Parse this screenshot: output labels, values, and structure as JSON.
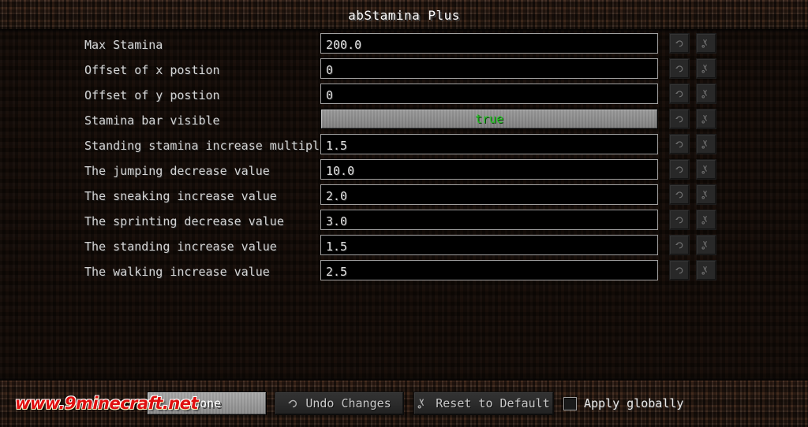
{
  "window": {
    "title": "abStamina Plus"
  },
  "options": [
    {
      "label": "Max Stamina",
      "type": "text",
      "value": "200.0"
    },
    {
      "label": "Offset of x postion",
      "type": "text",
      "value": "0"
    },
    {
      "label": "Offset of y postion",
      "type": "text",
      "value": "0"
    },
    {
      "label": "Stamina bar visible",
      "type": "boolean",
      "value": "true"
    },
    {
      "label": "Standing stamina increase multiplier",
      "type": "text",
      "value": "1.5"
    },
    {
      "label": "The jumping decrease value",
      "type": "text",
      "value": "10.0"
    },
    {
      "label": "The sneaking increase value",
      "type": "text",
      "value": "2.0"
    },
    {
      "label": "The sprinting decrease value",
      "type": "text",
      "value": "3.0"
    },
    {
      "label": "The standing increase value",
      "type": "text",
      "value": "1.5"
    },
    {
      "label": "The walking increase value",
      "type": "text",
      "value": "2.5"
    }
  ],
  "row_actions": {
    "undo_icon": "undo-arrow-icon",
    "reset_icon": "reset-to-default-icon"
  },
  "footer": {
    "done_label": "Done",
    "undo_label": "Undo Changes",
    "undo_icon": "undo-arrow-icon",
    "reset_label": "Reset to Default",
    "reset_icon": "reset-to-default-icon",
    "apply_globally_label": "Apply globally",
    "apply_globally_checked": false
  },
  "watermark": {
    "text": "www.9minecraft.net"
  },
  "colors": {
    "boolean_true": "#27c427",
    "watermark_red": "#e01010",
    "dirt": "#32221a",
    "button_gray": "#9a9a9a"
  }
}
